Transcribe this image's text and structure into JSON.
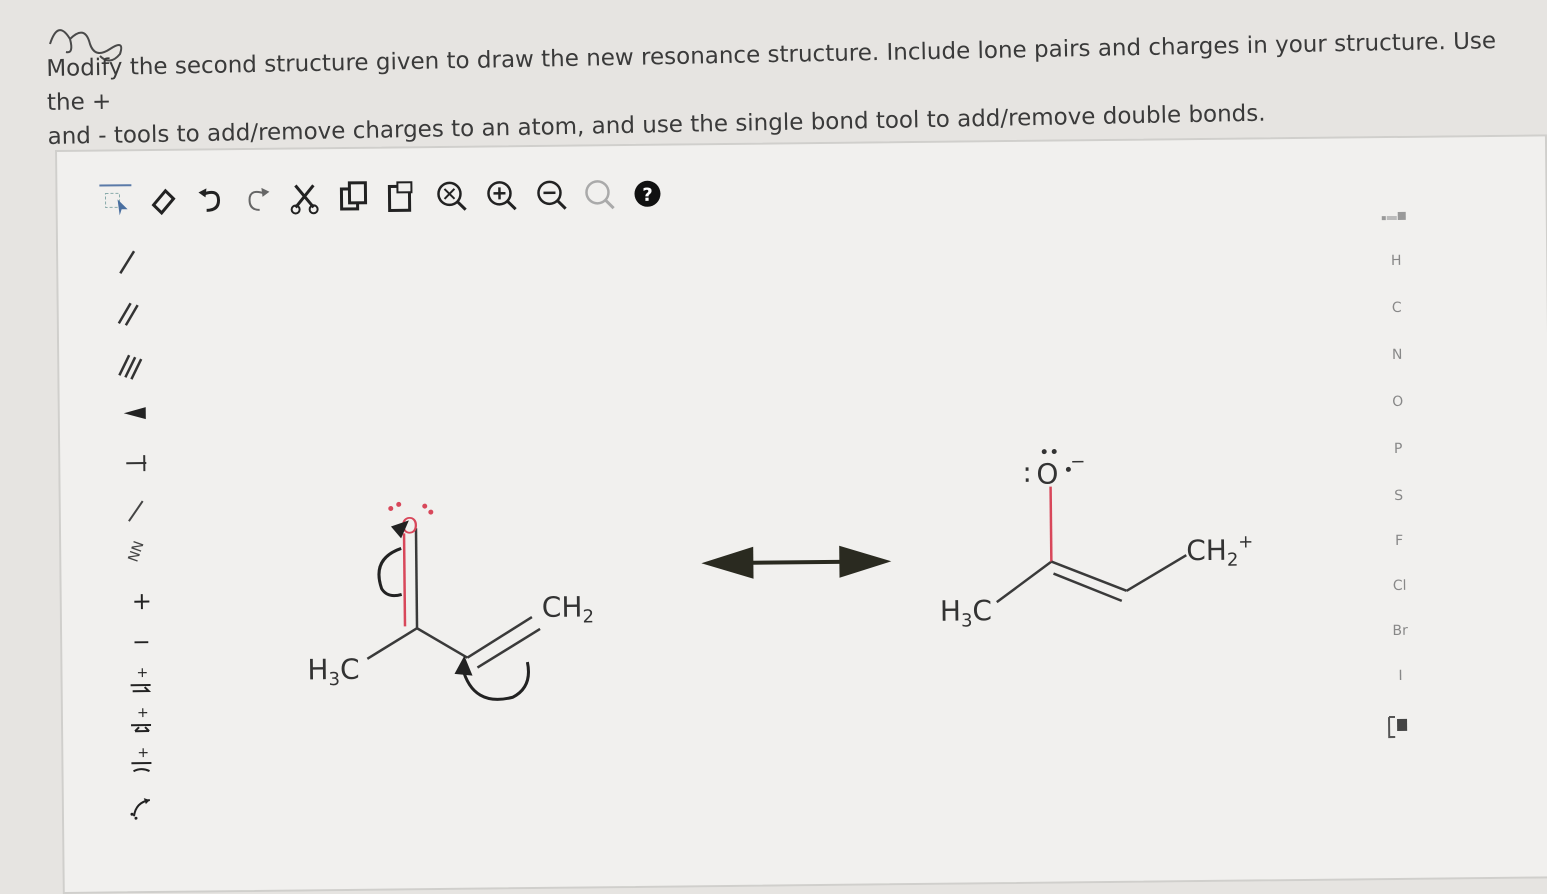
{
  "instructions": {
    "line1": "Modify the second structure given to draw the new resonance structure. Include lone pairs and charges in your structure. Use the +",
    "line2": "and - tools to add/remove charges to an atom, and use the single bond tool to add/remove double bonds."
  },
  "toolbar": {
    "icons": [
      "select-icon",
      "eraser-icon",
      "undo-icon",
      "redo-icon",
      "cut-icon",
      "copy-icon",
      "paste-icon",
      "clear-zoom-icon",
      "zoom-in-icon",
      "zoom-out-icon",
      "zoom-fit-icon",
      "help-icon"
    ]
  },
  "left_tools": {
    "plus_label": "+",
    "minus_label": "−"
  },
  "periodic": {
    "elements": [
      "H",
      "C",
      "N",
      "O",
      "P",
      "S",
      "F",
      "Cl",
      "Br",
      "I"
    ]
  },
  "molecule1": {
    "methyl_main": "H",
    "methyl_sub": "3",
    "methyl_c": "C",
    "ch2_main": "CH",
    "ch2_sub": "2",
    "oxygen": "O"
  },
  "molecule2": {
    "methyl_main": "H",
    "methyl_sub": "3",
    "methyl_c": "C",
    "ch2_main": "CH",
    "ch2_sub": "2",
    "ch2_charge": "+",
    "oxygen": "O",
    "oxygen_charge": "−",
    "lone_pair_left": ":"
  },
  "colors": {
    "oxygen_red": "#d8475a",
    "bond": "#3a3a3a",
    "arrow": "#2a2a20"
  }
}
